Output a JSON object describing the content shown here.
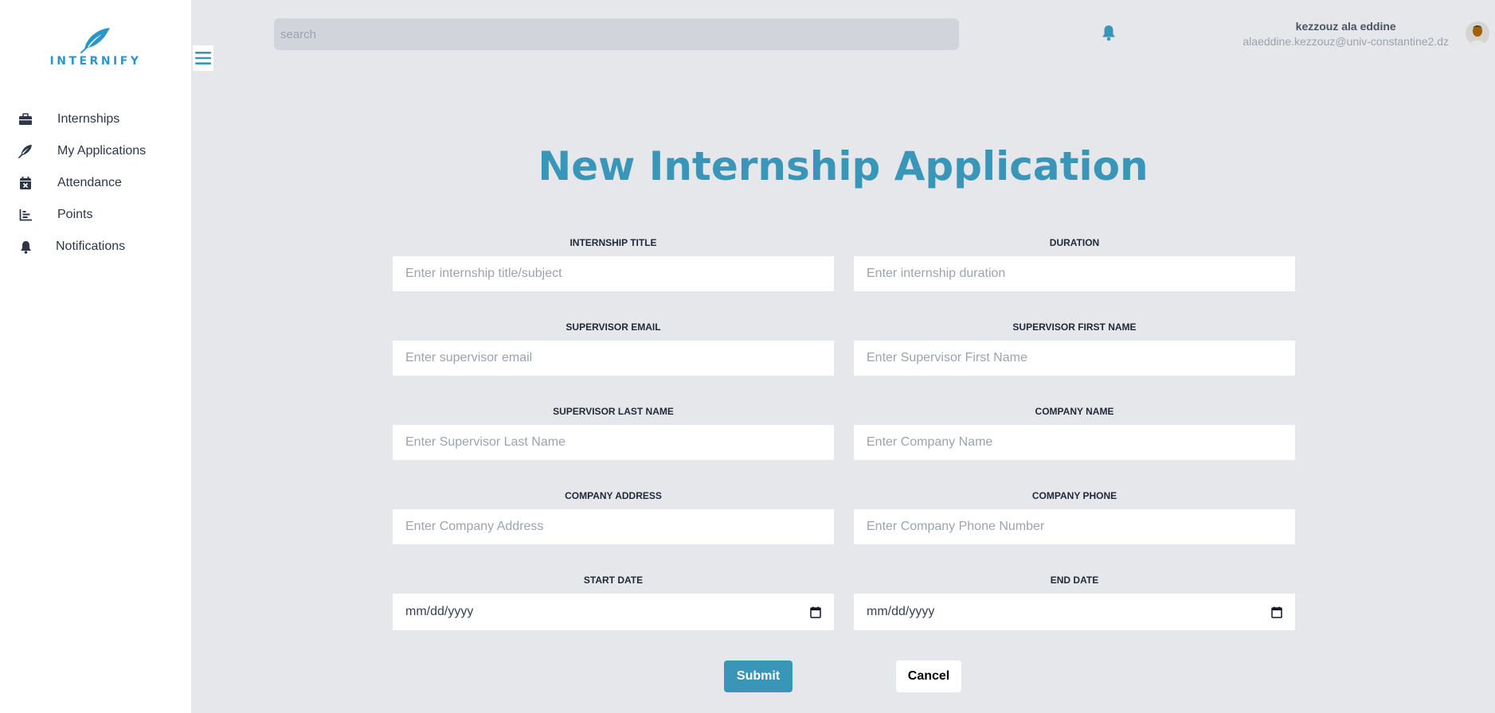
{
  "brand": {
    "name": "INTERNIFY",
    "color": "#2b97c9",
    "logo_icon": "feather-icon"
  },
  "sidebar": {
    "items": [
      {
        "label": "Internships",
        "icon": "briefcase-icon"
      },
      {
        "label": "My Applications",
        "icon": "feather-icon"
      },
      {
        "label": "Attendance",
        "icon": "calendar-x-icon"
      },
      {
        "label": "Points",
        "icon": "bar-chart-icon"
      },
      {
        "label": "Notifications",
        "icon": "bell-icon"
      }
    ]
  },
  "header": {
    "search_placeholder": "search",
    "notifications_icon": "bell-icon",
    "user": {
      "name": "kezzouz ala eddine",
      "email": "alaeddine.kezzouz@univ-constantine2.dz"
    }
  },
  "form": {
    "title": "New Internship Application",
    "fields": {
      "internship_title": {
        "label": "INTERNSHIP TITLE",
        "placeholder": "Enter internship title/subject"
      },
      "duration": {
        "label": "DURATION",
        "placeholder": "Enter internship duration"
      },
      "supervisor_email": {
        "label": "SUPERVISOR EMAIL",
        "placeholder": "Enter supervisor email"
      },
      "supervisor_first_name": {
        "label": "SUPERVISOR FIRST NAME",
        "placeholder": "Enter Supervisor First Name"
      },
      "supervisor_last_name": {
        "label": "SUPERVISOR LAST NAME",
        "placeholder": "Enter Supervisor Last Name"
      },
      "company_name": {
        "label": "COMPANY NAME",
        "placeholder": "Enter Company Name"
      },
      "company_address": {
        "label": "COMPANY ADDRESS",
        "placeholder": "Enter Company Address"
      },
      "company_phone": {
        "label": "COMPANY PHONE",
        "placeholder": "Enter Company Phone Number"
      },
      "start_date": {
        "label": "START DATE",
        "value": "mm/dd/yyyy"
      },
      "end_date": {
        "label": "END DATE",
        "value": "mm/dd/yyyy"
      }
    },
    "submit_label": "Submit",
    "cancel_label": "Cancel"
  },
  "colors": {
    "accent": "#3a96b8",
    "background": "#e5e7eb",
    "search_bg": "#d1d5db"
  }
}
